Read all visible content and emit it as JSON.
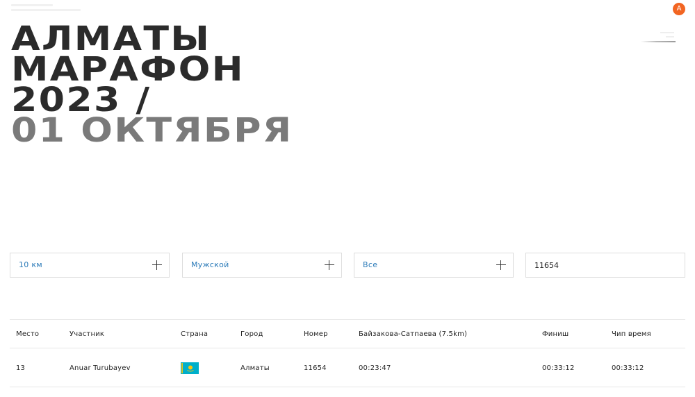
{
  "header": {
    "avatar_letter": "A"
  },
  "hero": {
    "line1": "АЛМАТЫ",
    "line2": "МАРАФОН",
    "line3": "2023 /",
    "line4": "01 ОКТЯБРЯ"
  },
  "filters": {
    "distance": "10 км",
    "gender": "Мужской",
    "category": "Все",
    "bib_search_value": "11654"
  },
  "table": {
    "columns": [
      "Место",
      "Участник",
      "Страна",
      "Город",
      "Номер",
      "Байзакова-Сатпаева (7.5km)",
      "Финиш",
      "Чип время"
    ],
    "rows": [
      {
        "place": "13",
        "participant": "Anuar Turubayev",
        "country_flag": "kazakhstan-flag-icon",
        "city": "Алматы",
        "bib": "11654",
        "split": "00:23:47",
        "finish": "00:33:12",
        "chip_time": "00:33:12"
      }
    ]
  },
  "colors": {
    "accent": "#2a7ab8",
    "avatar": "#f26522",
    "hero_dark": "#2b2b2b",
    "hero_grey": "#7a7a7a",
    "flag_blue": "#00afca",
    "flag_gold": "#fec50c"
  }
}
